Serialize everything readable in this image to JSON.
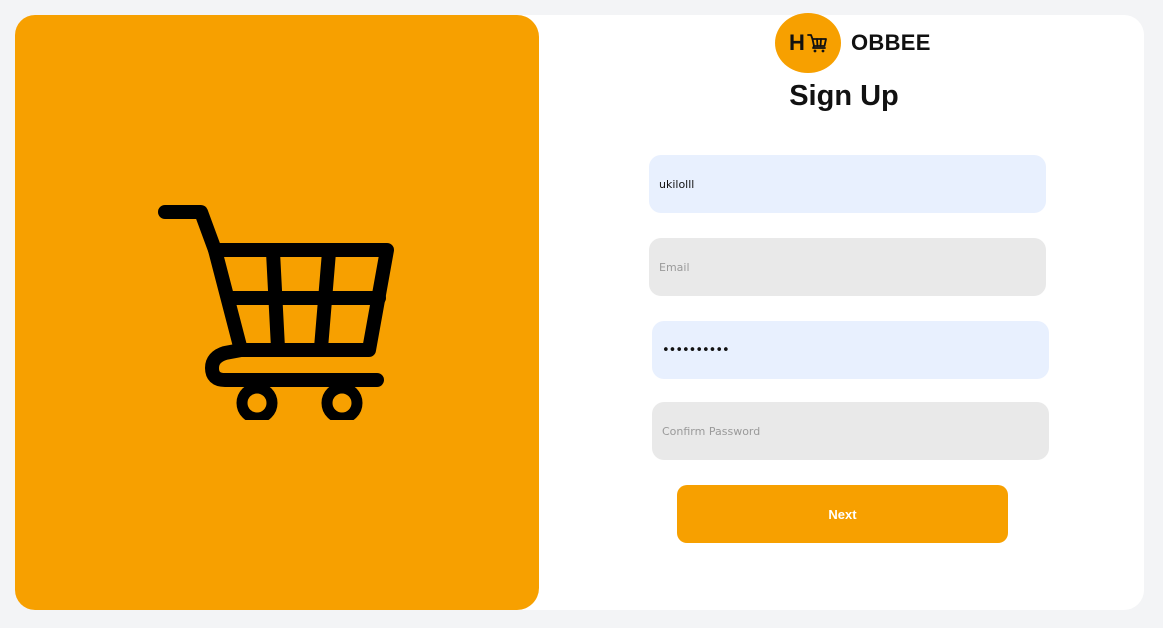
{
  "brand": {
    "logo_letter": "H",
    "name": "OBBEE",
    "accent_color": "#f7a000"
  },
  "hero": {
    "illustration_icon": "shopping-cart-icon"
  },
  "form": {
    "title": "Sign Up",
    "username": {
      "value": "ukilolll",
      "placeholder": ""
    },
    "email": {
      "value": "",
      "placeholder": "Email"
    },
    "password": {
      "value": "ukilolll12",
      "placeholder": ""
    },
    "confirm_password": {
      "value": "",
      "placeholder": "Confirm Password"
    },
    "next_label": "Next"
  }
}
